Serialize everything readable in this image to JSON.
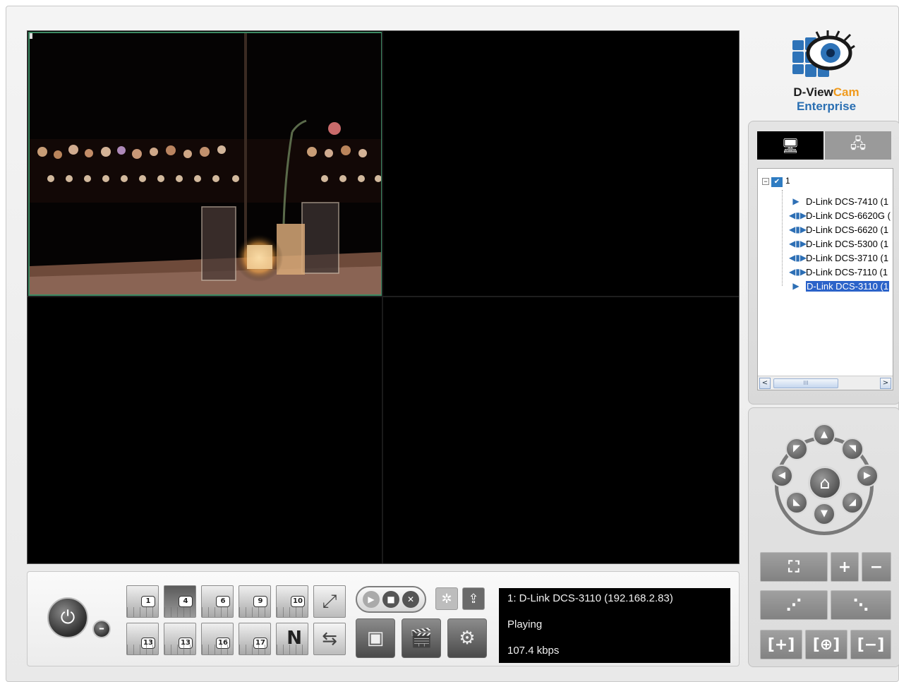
{
  "logo": {
    "brand_main": "D-View",
    "brand_accent": "Cam",
    "product": "Enterprise",
    "accent_color": "#f09a1c",
    "product_color": "#2a6fb2"
  },
  "tabs": [
    {
      "icon": "monitor-icon",
      "active": true
    },
    {
      "icon": "network-icon",
      "active": false
    }
  ],
  "tree": {
    "root_label": "1",
    "devices": [
      {
        "label": "D-Link DCS-7410 (1",
        "icon": "play-icon",
        "selected": false
      },
      {
        "label": "D-Link DCS-6620G (",
        "icon": "speaker-icon",
        "selected": false
      },
      {
        "label": "D-Link DCS-6620 (1",
        "icon": "speaker-icon",
        "selected": false
      },
      {
        "label": "D-Link DCS-5300 (1",
        "icon": "speaker-icon",
        "selected": false
      },
      {
        "label": "D-Link DCS-3710 (1",
        "icon": "speaker-icon",
        "selected": false
      },
      {
        "label": "D-Link DCS-7110 (1",
        "icon": "speaker-icon",
        "selected": false
      },
      {
        "label": "D-Link DCS-3110 (1",
        "icon": "play-icon",
        "selected": true
      }
    ],
    "scroll_left": "<",
    "scroll_right": ">",
    "scroll_thumb": "III"
  },
  "layouts": {
    "row1": [
      "1",
      "4",
      "6",
      "9",
      "10"
    ],
    "row2": [
      "13",
      "13",
      "16",
      "17",
      "N"
    ],
    "active_index": 1
  },
  "status": {
    "camera": "1: D-Link DCS-3110 (192.168.2.83)",
    "state": "Playing",
    "bitrate": "107.4 kbps"
  },
  "ptz": {
    "zoom_in": "+",
    "zoom_out": "−"
  }
}
